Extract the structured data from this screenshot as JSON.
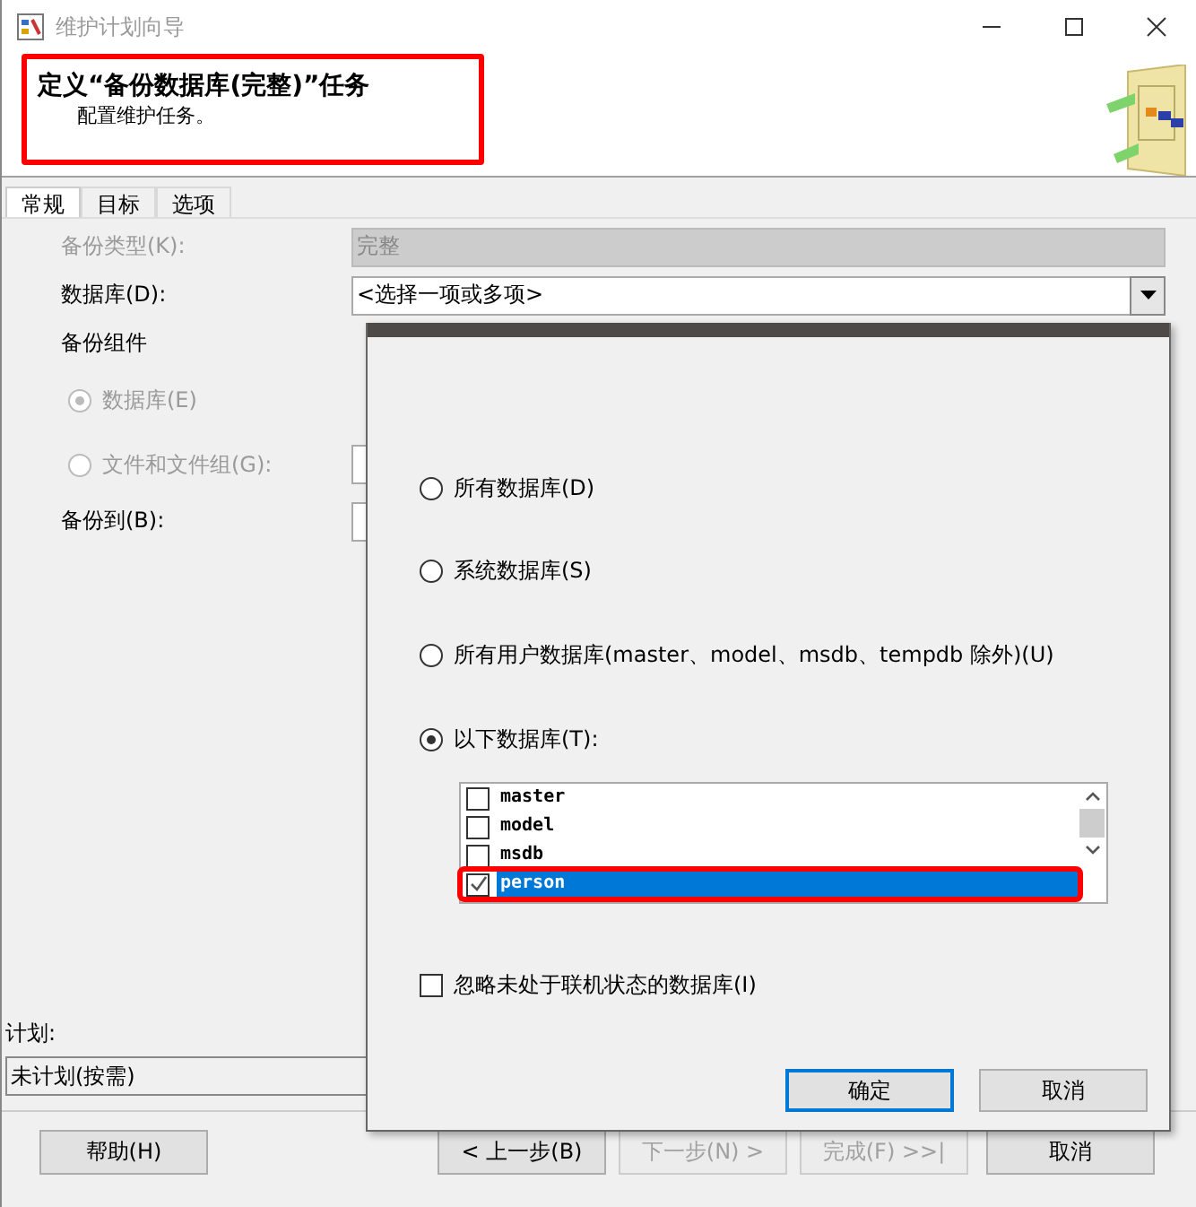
{
  "window": {
    "title": "维护计划向导"
  },
  "header": {
    "title": "定义“备份数据库(完整)”任务",
    "subtitle": "配置维护任务。",
    "highlighted": true
  },
  "tabs": [
    {
      "label": "常规",
      "selected": true
    },
    {
      "label": "目标",
      "selected": false
    },
    {
      "label": "选项",
      "selected": false
    }
  ],
  "form": {
    "backup_type": {
      "label": "备份类型(K):",
      "value": "完整",
      "disabled": true
    },
    "database": {
      "label": "数据库(D):",
      "value": "<选择一项或多项>"
    },
    "components_label": "备份组件",
    "components": [
      {
        "label": "数据库(E)",
        "selected": true,
        "disabled": true
      },
      {
        "label": "文件和文件组(G):",
        "selected": false,
        "disabled": true
      }
    ],
    "backup_to": {
      "label": "备份到(B):"
    }
  },
  "schedule": {
    "label": "计划:",
    "value": "未计划(按需)"
  },
  "popup": {
    "options": [
      {
        "label": "所有数据库(D)",
        "selected": false
      },
      {
        "label": "系统数据库(S)",
        "selected": false
      },
      {
        "label": "所有用户数据库(master、model、msdb、tempdb 除外)(U)",
        "selected": false
      },
      {
        "label": "以下数据库(T):",
        "selected": true
      }
    ],
    "databases": [
      {
        "name": "master",
        "checked": false,
        "selected": false,
        "highlighted": false
      },
      {
        "name": "model",
        "checked": false,
        "selected": false,
        "highlighted": false
      },
      {
        "name": "msdb",
        "checked": false,
        "selected": false,
        "highlighted": false
      },
      {
        "name": "person",
        "checked": true,
        "selected": true,
        "highlighted": true
      }
    ],
    "ignore_offline": {
      "label": "忽略未处于联机状态的数据库(I)",
      "checked": false
    },
    "buttons": [
      {
        "label": "确定",
        "default": true
      },
      {
        "label": "取消",
        "default": false
      }
    ]
  },
  "buttons": [
    {
      "label": "帮助(H)",
      "disabled": false
    },
    {
      "label": "< 上一步(B)",
      "disabled": false
    },
    {
      "label": "下一步(N) >",
      "disabled": true
    },
    {
      "label": "完成(F) >>|",
      "disabled": true
    },
    {
      "label": "取消",
      "disabled": false
    }
  ]
}
